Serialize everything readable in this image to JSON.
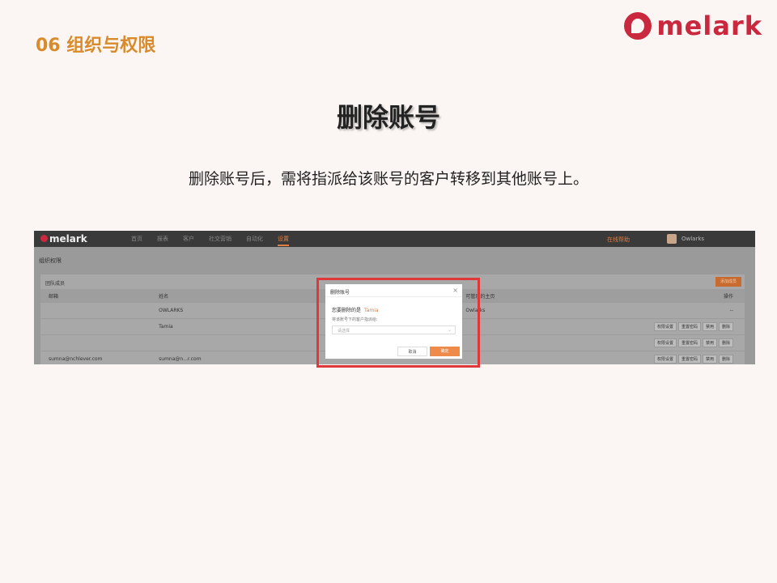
{
  "header": {
    "section": "06 组织与权限",
    "logo_text": "melark"
  },
  "title": "删除账号",
  "description": "删除账号后，需将指派给该账号的客户转移到其他账号上。",
  "screenshot": {
    "brand": "melark",
    "nav_tabs": [
      "首页",
      "报表",
      "客户",
      "社交营销",
      "自动化",
      "设置"
    ],
    "help": "在线帮助",
    "user": "Owlarks",
    "breadcrumb": "组织权限",
    "box_title": "团队成员",
    "add_button": "添加成员",
    "columns": [
      "邮箱",
      "姓名",
      "可管理的主页",
      "操作"
    ],
    "rows": [
      {
        "email": "",
        "name": "OWLARKS",
        "page": "Owlarks",
        "ops": [
          "--"
        ]
      },
      {
        "email": "",
        "name": "Tamia",
        "page": "",
        "ops": [
          "权限设置",
          "重置密码",
          "禁用",
          "删除"
        ]
      },
      {
        "email": "",
        "name": "",
        "page": "",
        "ops": [
          "权限设置",
          "重置密码",
          "禁用",
          "删除"
        ]
      },
      {
        "email": "sumna@nchlever.com",
        "name": "sumna@n...r.com",
        "page": "",
        "ops": [
          "权限设置",
          "重置密码",
          "禁用",
          "删除"
        ]
      }
    ],
    "modal": {
      "title": "删除账号",
      "confirm_prefix": "您要删除的是",
      "target_name": "Tamia",
      "transfer_label": "将该账号下的客户指派给:",
      "select_placeholder": "请选择",
      "cancel": "取消",
      "ok": "确定"
    }
  }
}
